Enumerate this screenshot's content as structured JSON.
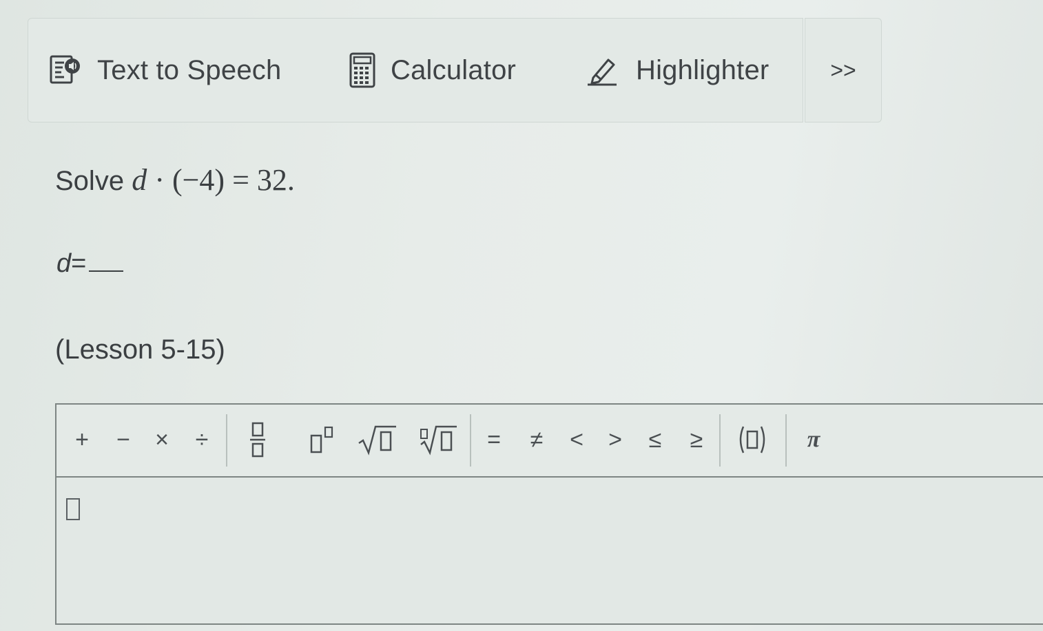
{
  "toolbar": {
    "text_to_speech_label": "Text to Speech",
    "calculator_label": "Calculator",
    "highlighter_label": "Highlighter",
    "more_label": ">>"
  },
  "question": {
    "prefix": "Solve",
    "variable": "d",
    "expression": "· (−4) = 32."
  },
  "answer": {
    "variable": "d",
    "equals": "="
  },
  "lesson": "(Lesson 5-15)",
  "palette": {
    "plus": "+",
    "minus": "−",
    "times": "×",
    "divide": "÷",
    "equals": "=",
    "not_equal": "≠",
    "less_than": "<",
    "greater_than": ">",
    "less_equal": "≤",
    "greater_equal": "≥",
    "pi": "π"
  }
}
